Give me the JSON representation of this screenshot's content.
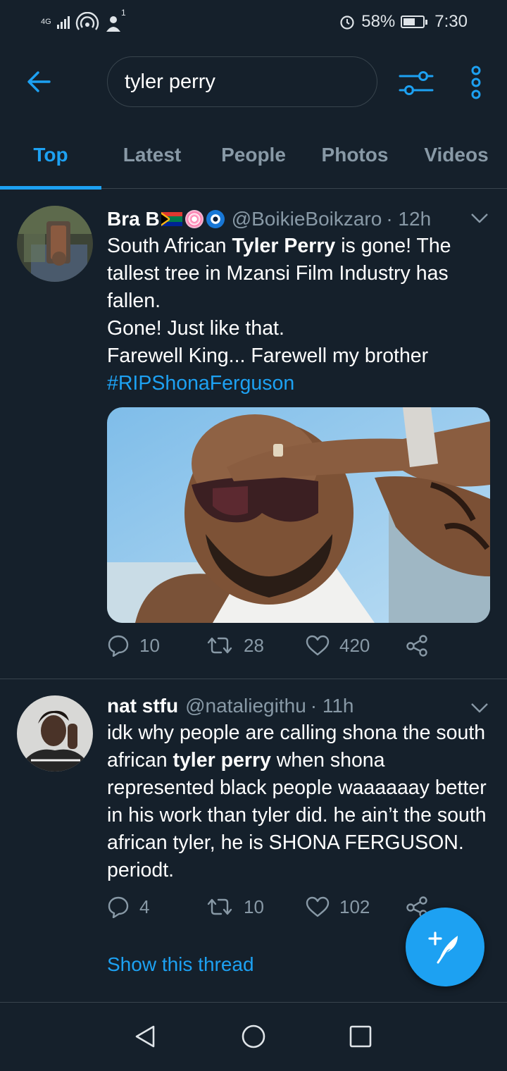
{
  "status_bar": {
    "network": "4G",
    "notification_count": "1",
    "battery": "58%",
    "time": "7:30"
  },
  "search": {
    "query": "tyler perry"
  },
  "tabs": [
    {
      "label": "Top",
      "active": true
    },
    {
      "label": "Latest",
      "active": false
    },
    {
      "label": "People",
      "active": false
    },
    {
      "label": "Photos",
      "active": false
    },
    {
      "label": "Videos",
      "active": false
    }
  ],
  "tweets": [
    {
      "name": "Bra B",
      "handle": "@BoikieBoikzaro",
      "time": "· 12h",
      "text_parts": {
        "p1": "South African ",
        "p1_bold": "Tyler Perry",
        "p2": " is gone! The tallest tree in Mzansi Film Industry has fallen.",
        "p3": "Gone! Just like that.",
        "p4": "Farewell King... Farewell my brother",
        "hashtag": "#RIPShonaFerguson"
      },
      "replies": "10",
      "retweets": "28",
      "likes": "420"
    },
    {
      "name": "nat stfu",
      "handle": "@nataliegithu",
      "time": "· 11h",
      "text_parts": {
        "p1": "idk why people are calling shona the south african ",
        "p1_bold": "tyler perry",
        "p2": " when shona represented black people waaaaaay better in his work than tyler did. he ain’t the south african tyler, he is SHONA FERGUSON. periodt."
      },
      "replies": "4",
      "retweets": "10",
      "likes": "102",
      "show_thread": "Show this thread"
    }
  ],
  "colors": {
    "background": "#15202b",
    "accent": "#1da1f2",
    "muted": "#8899a6",
    "divider": "#38444d"
  }
}
